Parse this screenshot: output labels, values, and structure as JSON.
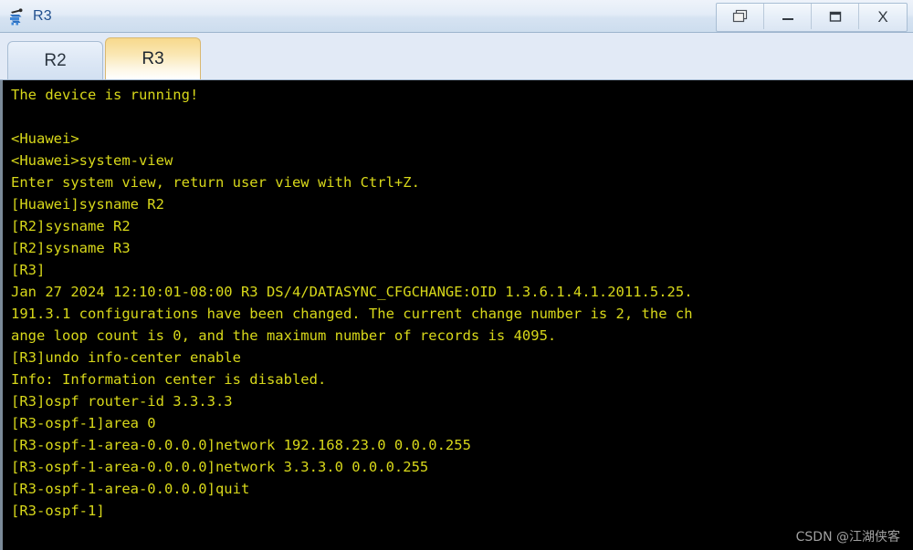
{
  "window": {
    "title": "R3",
    "icon": "router-device-icon",
    "buttons": [
      {
        "name": "restore-down-button",
        "glyph": "cascade-windows-icon",
        "label": ""
      },
      {
        "name": "minimize-button",
        "glyph": "minimize-icon",
        "label": "_"
      },
      {
        "name": "maximize-button",
        "glyph": "maximize-icon",
        "label": ""
      },
      {
        "name": "close-button",
        "glyph": "close-icon",
        "label": "X"
      }
    ]
  },
  "tabs": [
    {
      "label": "R2",
      "active": false
    },
    {
      "label": "R3",
      "active": true
    }
  ],
  "colors": {
    "terminal_bg": "#000000",
    "terminal_fg": "#d8d81a",
    "titlebar_text": "#21508f",
    "tab_active_accent": "#f7d98c",
    "watermark": "#bdbdbd"
  },
  "terminal": {
    "lines": [
      "The device is running!",
      "",
      "<Huawei>",
      "<Huawei>system-view",
      "Enter system view, return user view with Ctrl+Z.",
      "[Huawei]sysname R2",
      "[R2]sysname R2",
      "[R2]sysname R3",
      "[R3]",
      "Jan 27 2024 12:10:01-08:00 R3 DS/4/DATASYNC_CFGCHANGE:OID 1.3.6.1.4.1.2011.5.25.",
      "191.3.1 configurations have been changed. The current change number is 2, the ch",
      "ange loop count is 0, and the maximum number of records is 4095.",
      "[R3]undo info-center enable",
      "Info: Information center is disabled.",
      "[R3]ospf router-id 3.3.3.3",
      "[R3-ospf-1]area 0",
      "[R3-ospf-1-area-0.0.0.0]network 192.168.23.0 0.0.0.255",
      "[R3-ospf-1-area-0.0.0.0]network 3.3.3.0 0.0.0.255",
      "[R3-ospf-1-area-0.0.0.0]quit",
      "[R3-ospf-1]"
    ]
  },
  "watermark": {
    "text": "CSDN @江湖侠客"
  }
}
